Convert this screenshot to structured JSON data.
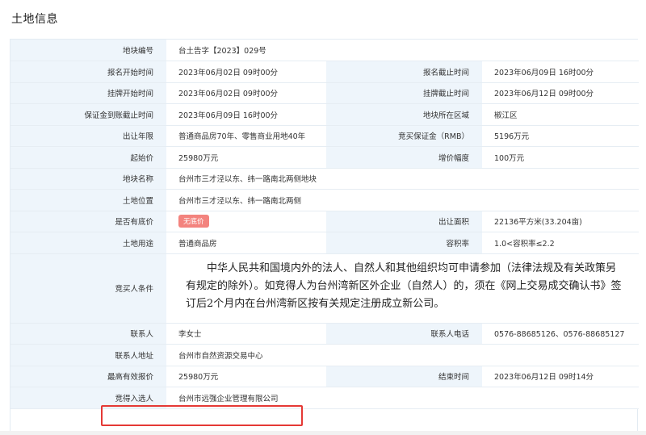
{
  "section_title": "土地信息",
  "colors": {
    "label_bg": "#eef5fb",
    "badge_bg": "#f3837e",
    "highlight_border": "#e53935"
  },
  "rows": {
    "plot_no": {
      "label": "地块编号",
      "value": "台土告字【2023】029号"
    },
    "signup_start": {
      "label": "报名开始时间",
      "value": "2023年06月02日 09时00分"
    },
    "signup_end": {
      "label": "报名截止时间",
      "value": "2023年06月09日 16时00分"
    },
    "listing_start": {
      "label": "挂牌开始时间",
      "value": "2023年06月02日 09时00分"
    },
    "listing_end": {
      "label": "挂牌截止时间",
      "value": "2023年06月12日 09时00分"
    },
    "deposit_deadline": {
      "label": "保证金到账截止时间",
      "value": "2023年06月09日 16时00分"
    },
    "district": {
      "label": "地块所在区域",
      "value": "椒江区"
    },
    "term": {
      "label": "出让年限",
      "value": "普通商品房70年、零售商业用地40年"
    },
    "deposit": {
      "label": "竞买保证金（RMB）",
      "value": "5196万元"
    },
    "start_price": {
      "label": "起始价",
      "value": "25980万元"
    },
    "increment": {
      "label": "增价幅度",
      "value": "100万元"
    },
    "plot_name": {
      "label": "地块名称",
      "value": "台州市三才泾以东、纬一路南北两侧地块"
    },
    "location": {
      "label": "土地位置",
      "value": "台州市三才泾以东、纬一路南北两侧"
    },
    "reserve": {
      "label": "是否有底价",
      "value": "无底价"
    },
    "area": {
      "label": "出让面积",
      "value": "22136平方米(33.204亩)"
    },
    "usage": {
      "label": "土地用途",
      "value": "普通商品房"
    },
    "far": {
      "label": "容积率",
      "value": "1.0<容积率≤2.2"
    },
    "conditions": {
      "label": "竞买人条件",
      "value": "中华人民共和国境内外的法人、自然人和其他组织均可申请参加（法律法规及有关政策另有规定的除外）。如竞得人为台州湾新区外企业（自然人）的，须在《网上交易成交确认书》签订后2个月内在台州湾新区按有关规定注册成立新公司。"
    },
    "contact": {
      "label": "联系人",
      "value": "李女士"
    },
    "phone": {
      "label": "联系人电话",
      "value": "0576-88685126、0576-88685127"
    },
    "address": {
      "label": "联系人地址",
      "value": "台州市自然资源交易中心"
    },
    "max_bid": {
      "label": "最高有效报价",
      "value": "25980万元"
    },
    "end_time": {
      "label": "结束时间",
      "value": "2023年06月12日 09时14分"
    },
    "winner": {
      "label": "竞得入选人",
      "value": "台州市远强企业管理有限公司"
    }
  }
}
